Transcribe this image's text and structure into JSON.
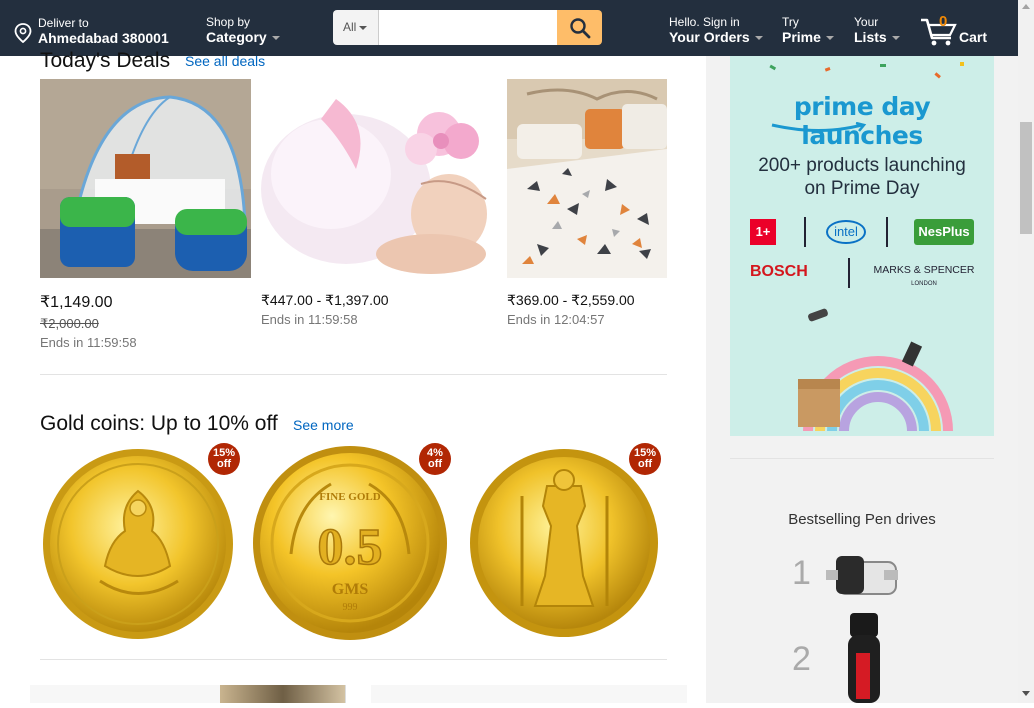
{
  "header": {
    "deliver_to": "Deliver to",
    "location": "Ahmedabad 380001",
    "shop_by": "Shop by",
    "category": "Category",
    "search_scope": "All",
    "search_placeholder": "",
    "hello_sign_in": "Hello. Sign in",
    "your_orders": "Your Orders",
    "try": "Try",
    "prime": "Prime",
    "your": "Your",
    "lists": "Lists",
    "cart_count": "0",
    "cart": "Cart"
  },
  "deals": {
    "title": "Today's Deals",
    "see_all": "See all deals",
    "items": [
      {
        "name": "mosquito-net-tent",
        "price": "₹1,149.00",
        "old_price": "₹2,000.00",
        "ends": "Ends in 11:59:58"
      },
      {
        "name": "baby-tutu-headband",
        "price": "₹447.00 - ₹1,397.00",
        "ends": "Ends in 11:59:58"
      },
      {
        "name": "bedsheet-set",
        "price": "₹369.00 - ₹2,559.00",
        "ends": "Ends in 12:04:57"
      }
    ]
  },
  "gold": {
    "title": "Gold coins: Up to 10% off",
    "see_more": "See more",
    "items": [
      {
        "badge_pct": "15%",
        "badge_off": "off"
      },
      {
        "badge_pct": "4%",
        "badge_off": "off",
        "coin_top": "FINE GOLD",
        "coin_value": "0.5",
        "coin_unit": "GMS",
        "coin_purity": "999"
      },
      {
        "badge_pct": "15%",
        "badge_off": "off"
      }
    ]
  },
  "sidebar": {
    "promo_title": "prime day launches",
    "promo_sub1": "200+ products launching",
    "promo_sub2": "on Prime Day",
    "brands": [
      "1+",
      "intel",
      "NesPlus",
      "BOSCH",
      "MARKS & SPENCER",
      "LONDON"
    ],
    "bestselling_title": "Bestselling Pen drives",
    "ranks": [
      "1",
      "2"
    ]
  },
  "colors": {
    "header_bg": "#232f3e",
    "search_button": "#febd69",
    "link": "#0066c0",
    "badge": "#b12704",
    "cart_count": "#f08804"
  }
}
